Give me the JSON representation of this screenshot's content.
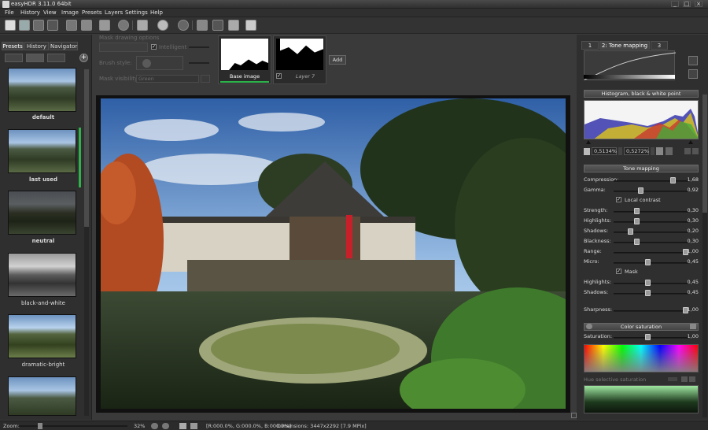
{
  "window": {
    "title": "easyHDR 3.11.0 64bit",
    "minimize": "_",
    "maximize": "□",
    "close": "×"
  },
  "menu": [
    "File",
    "History",
    "View",
    "Image",
    "Presets",
    "Layers",
    "Settings",
    "Help"
  ],
  "toolbar_icons": [
    "new-file-icon",
    "save-icon",
    "save-as-icon",
    "fit-icon",
    "export-icon",
    "batch-icon",
    "settings-icon",
    "load-image-icon",
    "history-back-icon",
    "history-forward-icon",
    "undo-icon",
    "redo-icon",
    "flatten-icon",
    "layers-icon"
  ],
  "left_panel": {
    "tabs": [
      "Presets",
      "History",
      "Navigator"
    ],
    "presets": [
      {
        "label": "default",
        "bold": true
      },
      {
        "label": "last used",
        "bold": true
      },
      {
        "label": "neutral",
        "bold": true
      },
      {
        "label": "black-and-white",
        "bold": false
      },
      {
        "label": "dramatic-bright",
        "bold": false
      },
      {
        "label": "",
        "bold": false
      }
    ],
    "add": "+"
  },
  "mask": {
    "title": "Mask drawing options",
    "intelligent": "Intelligent",
    "brush_style": "Brush style:",
    "mask_visibility": "Mask visibility:",
    "visibility_value": "Green",
    "layers": [
      {
        "label": "Base image",
        "active": true
      },
      {
        "label": "Layer 7",
        "active": false
      }
    ],
    "add_button": "Add"
  },
  "right_panel": {
    "tabs": [
      "1",
      "2: Tone mapping",
      "3"
    ],
    "histogram_title": "Histogram, black & white point",
    "black_point": "0,5134%",
    "white_point": "0,5272%",
    "tone_title": "Tone mapping",
    "sliders1": [
      {
        "label": "Compression:",
        "value": "1,68",
        "pos": 0.82
      },
      {
        "label": "Gamma:",
        "value": "0,92",
        "pos": 0.35
      }
    ],
    "local_contrast": "Local contrast",
    "sliders2": [
      {
        "label": "Strength:",
        "value": "0,30",
        "pos": 0.3
      },
      {
        "label": "Highlights:",
        "value": "0,30",
        "pos": 0.3
      },
      {
        "label": "Shadows:",
        "value": "0,20",
        "pos": 0.2
      },
      {
        "label": "Blackness:",
        "value": "0,30",
        "pos": 0.3
      },
      {
        "label": "Range:",
        "value": "1,00",
        "pos": 1.0
      },
      {
        "label": "Micro:",
        "value": "0,45",
        "pos": 0.45
      }
    ],
    "mask": "Mask",
    "sliders3": [
      {
        "label": "Highlights:",
        "value": "0,45",
        "pos": 0.45
      },
      {
        "label": "Shadows:",
        "value": "0,45",
        "pos": 0.45
      }
    ],
    "sharpness": {
      "label": "Sharpness:",
      "value": "1,00",
      "pos": 1.0
    },
    "color_title": "Color saturation",
    "saturation": {
      "label": "Saturation:",
      "value": "1,00",
      "pos": 0.45
    },
    "hue_selective": "Hue selective saturation"
  },
  "status": {
    "zoom_label": "Zoom:",
    "zoom": "32%",
    "rgb": "[R:000.0%, G:000.0%, B:000.0%]",
    "dimensions": "Dimensions: 3447x2292 [7.9 MPix]"
  }
}
